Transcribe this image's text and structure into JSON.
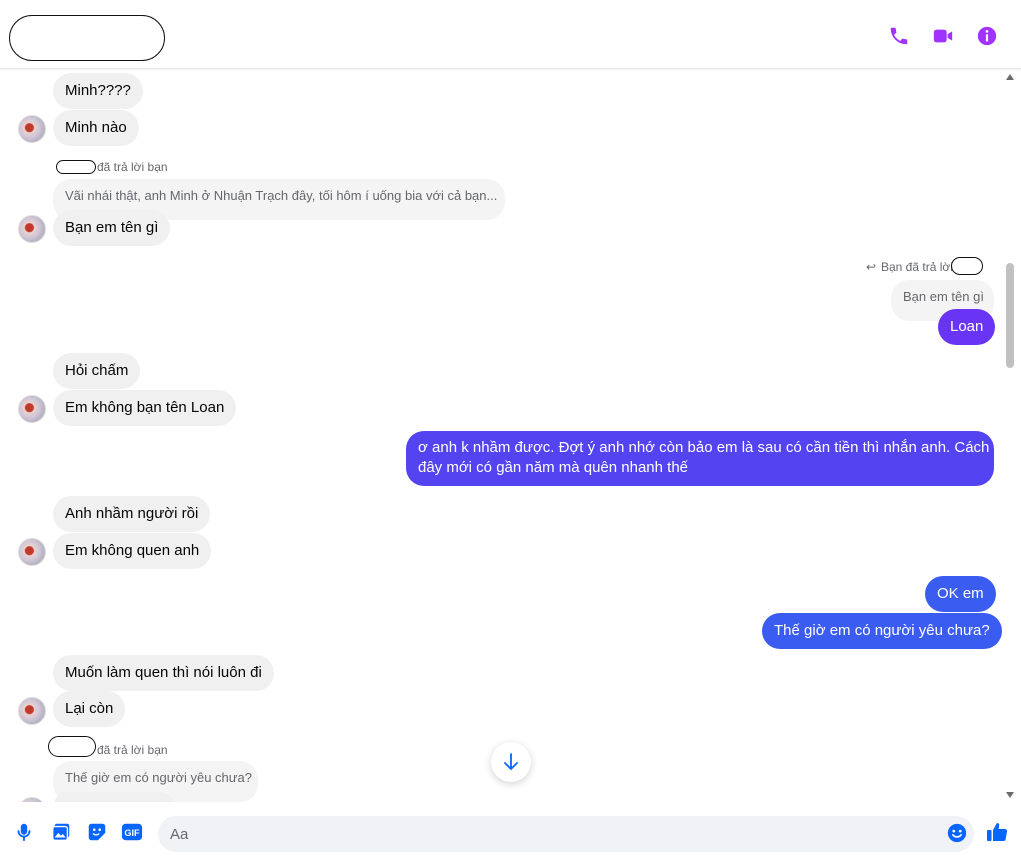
{
  "colors": {
    "accent": "#a033ff",
    "out_purple": "#6a34f5",
    "out_violet": "#5343f0",
    "out_blue": "#3b5cf0",
    "composer_blue": "#0866ff"
  },
  "header": {
    "icons": [
      "phone-icon",
      "video-icon",
      "info-icon"
    ]
  },
  "messages": {
    "m1": "Minh????",
    "m2": "Minh nào",
    "reply1_label": "đã trả lời bạn",
    "reply1_quote": "Vãi nhái thật, anh Minh ở Nhuận Trạch đây, tối hôm í uống bia với cả bạn...",
    "m3": "Bạn em tên gì",
    "reply2_label": "Bạn đã trả lời",
    "reply2_quote": "Bạn em tên gì",
    "m4": "Loan",
    "m5": "Hỏi chấm",
    "m6": "Em không bạn tên Loan",
    "m7_line1": "ơ anh k nhầm được. Đợt ý anh nhớ còn bảo em là sau có cần tiền thì nhắn anh. Cách",
    "m7_line2": "đây mới có gần năm mà quên nhanh thế",
    "m8": "Anh nhầm người rồi",
    "m9": "Em không quen anh",
    "m10": "OK em",
    "m11": "Thế giờ em có người yêu chưa?",
    "m12": "Muốn làm quen thì nói luôn đi",
    "m13": "Lại còn",
    "reply3_label": "đã trả lời bạn",
    "reply3_quote": "Thế giờ em có người yêu chưa?"
  },
  "composer": {
    "placeholder": "Aa",
    "icons": [
      "microphone-icon",
      "image-icon",
      "sticker-icon",
      "gif-icon",
      "emoji-icon",
      "like-icon"
    ],
    "gif_label": "GIF"
  }
}
